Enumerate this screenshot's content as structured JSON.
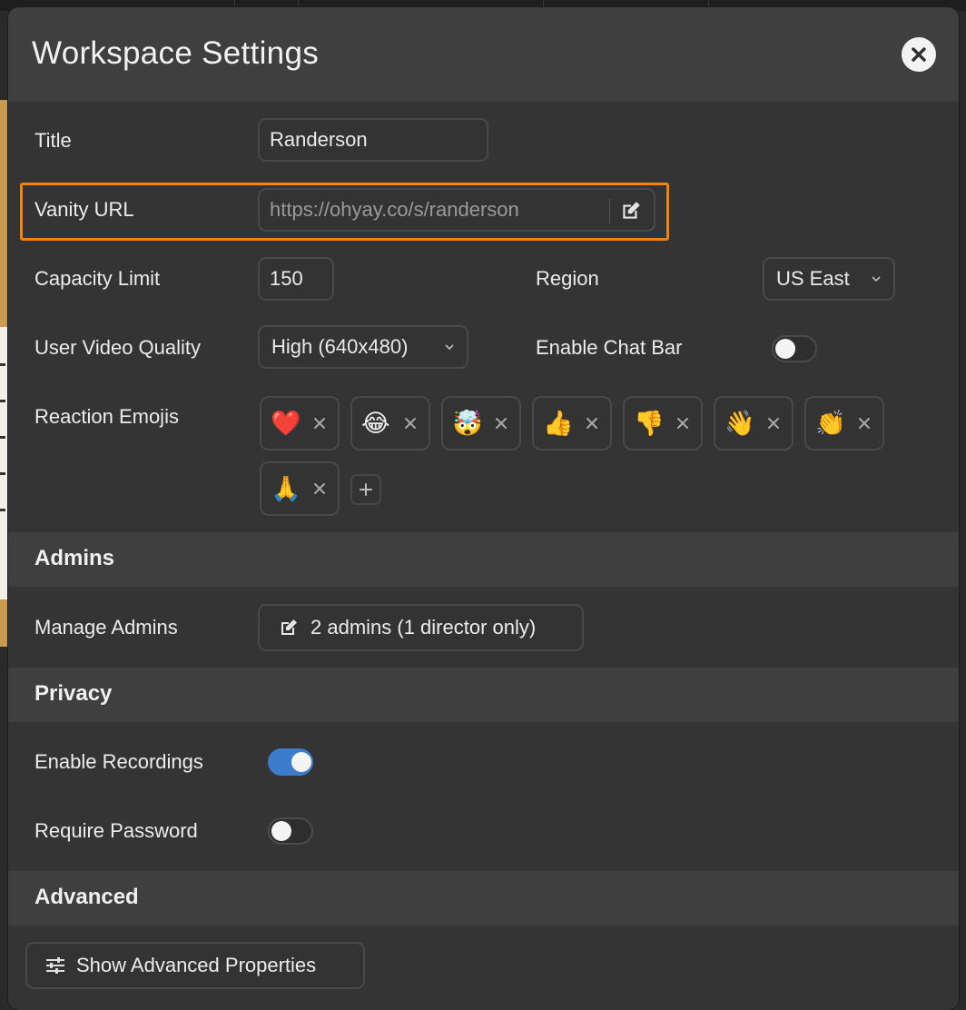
{
  "modal": {
    "title": "Workspace Settings",
    "close_icon": "close-circle-icon"
  },
  "general": {
    "title_label": "Title",
    "title_value": "Randerson",
    "vanity_label": "Vanity URL",
    "vanity_value": "https://ohyay.co/s/randerson",
    "capacity_label": "Capacity Limit",
    "capacity_value": "150",
    "region_label": "Region",
    "region_value": "US East",
    "video_label": "User Video Quality",
    "video_value": "High (640x480)",
    "chatbar_label": "Enable Chat Bar",
    "chatbar_enabled": false,
    "emoji_label": "Reaction Emojis",
    "emojis": [
      "❤️",
      "😂",
      "🤯",
      "👍",
      "👎",
      "👋",
      "👏",
      "🙏"
    ],
    "remove_symbol": "×",
    "add_symbol": "+"
  },
  "admins": {
    "section_title": "Admins",
    "manage_label": "Manage Admins",
    "manage_button": "2 admins (1 director only)"
  },
  "privacy": {
    "section_title": "Privacy",
    "recordings_label": "Enable Recordings",
    "recordings_enabled": true,
    "password_label": "Require Password",
    "password_enabled": false
  },
  "advanced": {
    "section_title": "Advanced",
    "show_button": "Show Advanced Properties"
  },
  "colors": {
    "highlight": "#f5820d",
    "toggle_on": "#3d7ccc",
    "panel": "#343434",
    "header": "#3f3f3f"
  }
}
